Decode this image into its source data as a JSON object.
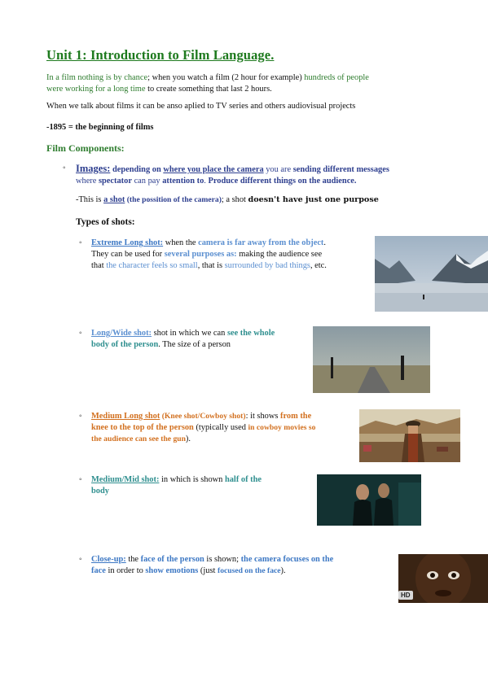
{
  "title": "Unit 1: Introduction to Film Language.",
  "intro": {
    "a": "In a film nothing is by chance",
    "b": "; when you watch a film (2 hour for example) ",
    "c": "hundreds of people",
    "d": "were working for a long time",
    "e": " to create something that last 2 hours."
  },
  "para2": "When we talk about films it can be anso aplied to TV series and others audiovisual projects",
  "date_line": "-1895 = the beginning of films",
  "components_heading": "Film Components:",
  "images": {
    "label": "Images:",
    "t1": " depending on ",
    "t2": "where you place the camera",
    "t3": " you are ",
    "t4": "sending different messages",
    "t5": "where ",
    "t6": "spectator",
    "t7": " can pay ",
    "t8": "attention to",
    "t9": ". ",
    "t10": "Produce different things on the audience.",
    "shot1": "-This is ",
    "shot2": "a shot",
    "shot3": " (the possition of the camera)",
    "shot4": "; a shot ",
    "shot5": "doesn't have just one purpose"
  },
  "types_heading": "Types of shots:",
  "shots": [
    {
      "name": "Extreme Long shot:",
      "l1a": " when the ",
      "l1b": "camera is far away from the object",
      "l1c": ".",
      "l2a": "They can be used for ",
      "l2b": "several purposes as:",
      "l2c": " making the audience see",
      "l3a": "that ",
      "l3b": "the character feels so small",
      "l3c": ", that is ",
      "l3d": "surrounded by bad things",
      "l3e": ", etc."
    },
    {
      "name": "Long/Wide shot:",
      "l1a": " shot in which we can ",
      "l1b": "see the whole",
      "l2a": "body of the person",
      "l2b": ". The size of a person"
    },
    {
      "name": "Medium Long shot",
      "l1a": " (Knee shot/Cowboy shot)",
      "l1b": ": it shows ",
      "l1c": "from the",
      "l2a": "knee to the top of the person",
      "l2b": " (typically used ",
      "l2c": "in cowboy movies so",
      "l3a": "the audience can see the gun",
      "l3b": ")."
    },
    {
      "name": "Medium/Mid shot:",
      "l1a": " in which is shown ",
      "l1b": "half of the",
      "l2a": "body"
    },
    {
      "name": "Close-up:",
      "l1a": " the ",
      "l1b": "face of the person",
      "l1c": " is shown; ",
      "l1d": "the camera focuses on the",
      "l2a": "face",
      "l2b": " in order to ",
      "l2c": "show emotions",
      "l2d": " (just ",
      "l2e": "focused on the face",
      "l2f": ")."
    }
  ],
  "hd_badge": "HD"
}
